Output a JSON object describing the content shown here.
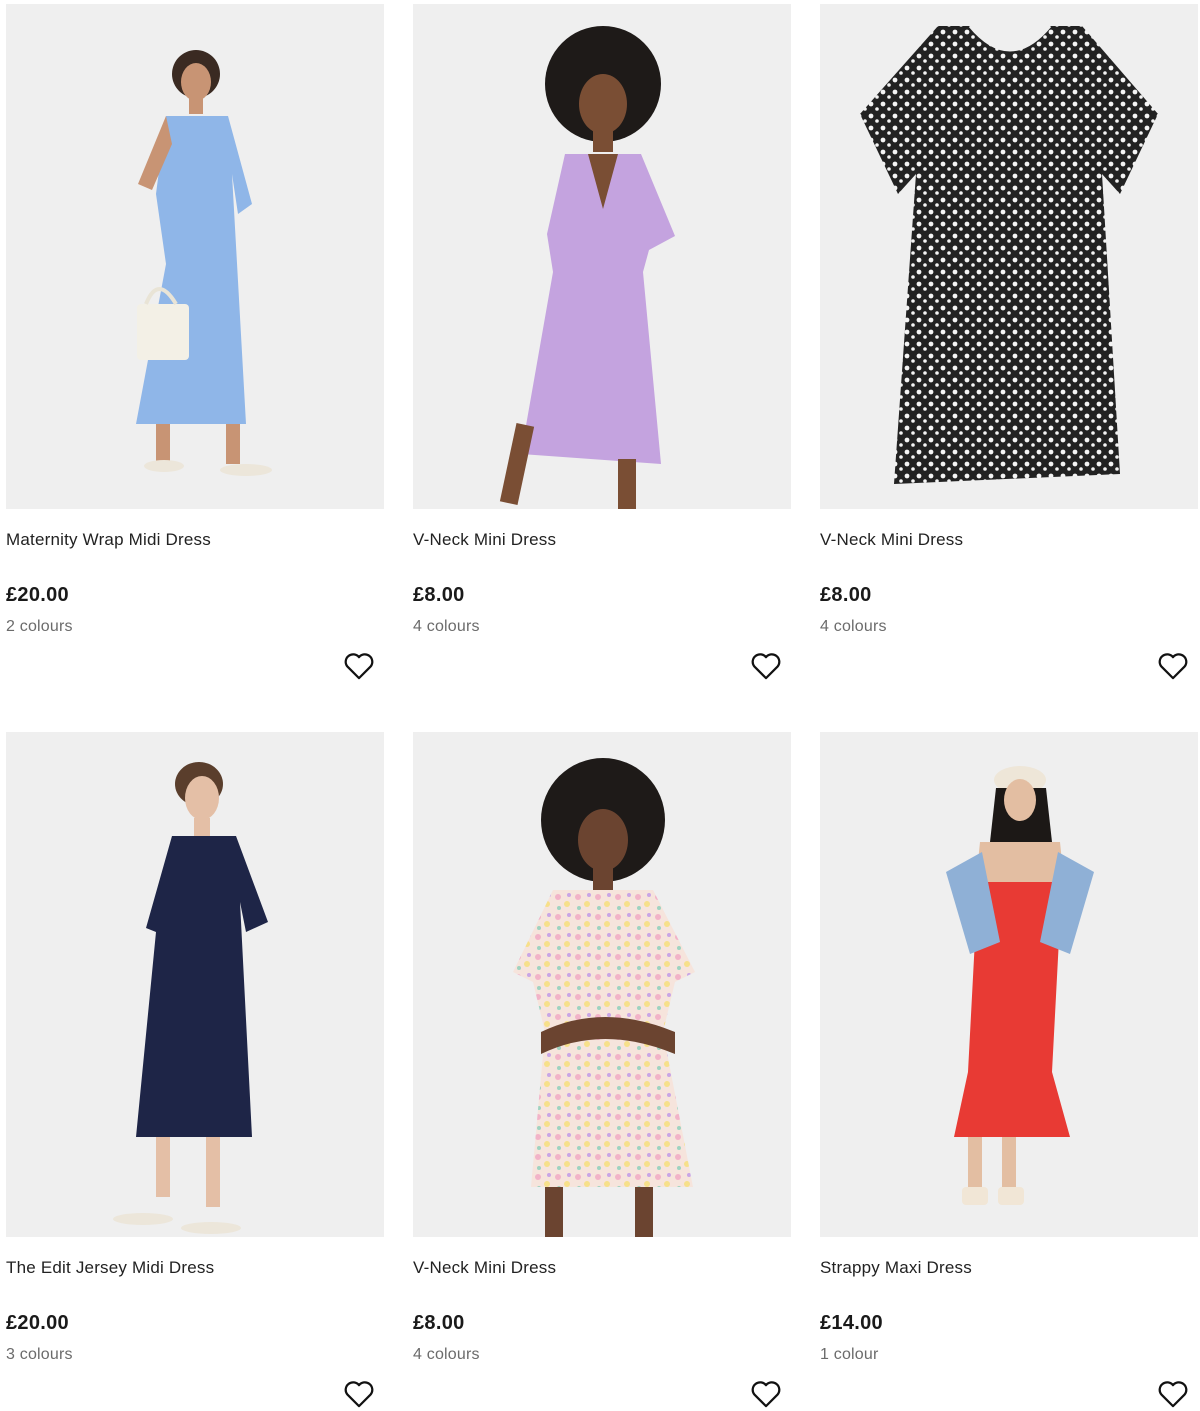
{
  "products": [
    {
      "name": "Maternity Wrap Midi Dress",
      "price": "£20.00",
      "colours": "2 colours",
      "dress_color": "#8fb6e8",
      "image": "woman-in-blue-wrap-midi-dress"
    },
    {
      "name": "V-Neck Mini Dress",
      "price": "£8.00",
      "colours": "4 colours",
      "dress_color": "#c4a3df",
      "image": "woman-in-lilac-mini-dress"
    },
    {
      "name": "V-Neck Mini Dress",
      "price": "£8.00",
      "colours": "4 colours",
      "dress_color": "#2a2a2a",
      "image": "black-and-white-print-dress-flat"
    },
    {
      "name": "The Edit Jersey Midi Dress",
      "price": "£20.00",
      "colours": "3 colours",
      "dress_color": "#1e2547",
      "image": "woman-in-navy-jersey-midi-dress"
    },
    {
      "name": "V-Neck Mini Dress",
      "price": "£8.00",
      "colours": "4 colours",
      "dress_color": "#f2d6cf",
      "image": "woman-in-floral-mini-dress"
    },
    {
      "name": "Strappy Maxi Dress",
      "price": "£14.00",
      "colours": "1 colour",
      "dress_color": "#e83a34",
      "image": "woman-in-red-strappy-maxi-dress"
    }
  ],
  "wishlist_icon": "heart-outline-icon"
}
